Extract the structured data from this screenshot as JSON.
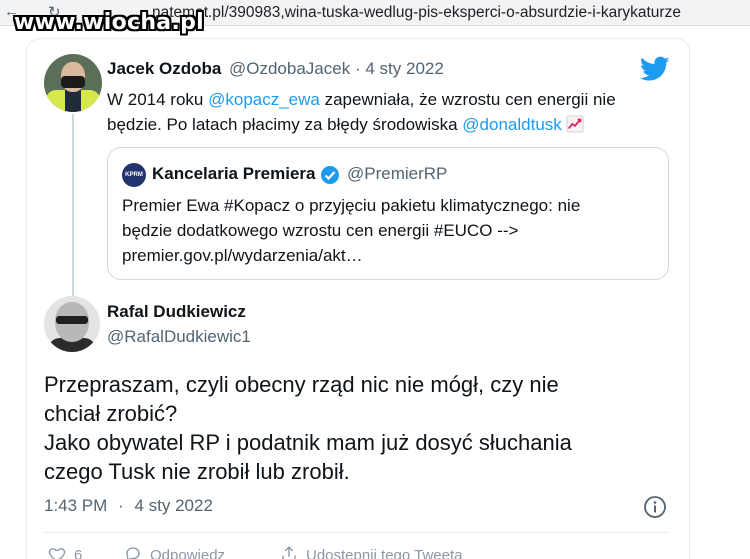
{
  "browser": {
    "back_icon": "back-arrow-icon",
    "reload_icon": "reload-icon",
    "url": "natemat.pl/390983,wina-tuska-wedlug-pis-eksperci-o-absurdzie-i-karykaturze"
  },
  "watermark": "www.wiocha.pl",
  "tweet1": {
    "name": "Jacek Ozdoba",
    "handle": "@OzdobaJacek",
    "separator": "·",
    "date": "4 sty 2022",
    "lines": [
      [
        "W 2014 roku ",
        "@kopacz_ewa",
        " zapewniała, że wzrostu cen energii nie"
      ],
      [
        "będzie. Po latach płacimy za błędy środowiska ",
        "@donaldtusk"
      ]
    ],
    "icons": [
      "twitter-bird-icon",
      "chart-increasing-emoji-icon"
    ]
  },
  "quote": {
    "avatar_text": "KPRM",
    "name": "Kancelaria Premiera",
    "handle": "@PremierRP",
    "lines": [
      "Premier Ewa #Kopacz o przyjęciu pakietu klimatycznego: nie",
      "będzie dodatkowego wzrostu cen energii #EUCO -->",
      "premier.gov.pl/wydarzenia/akt…"
    ]
  },
  "tweet2": {
    "name": "Rafal Dudkiewicz",
    "handle": "@RafalDudkiewic1",
    "lines": [
      "Przepraszam, czyli obecny rząd nic nie mógł, czy nie",
      "chciał zrobić?",
      "Jako obywatel RP i podatnik mam już dosyć słuchania",
      "czego Tusk nie zrobił lub zrobił."
    ],
    "time": "1:43 PM",
    "separator": "·",
    "date": "4 sty 2022"
  },
  "actions": {
    "like_count": "6",
    "reply_label": "Odpowiedz",
    "share_label": "Udostępnij tego Tweeta"
  },
  "colors": {
    "link": "#1d9bf0",
    "secondary_text": "#536471",
    "twitter_blue": "#1d9bf0"
  }
}
